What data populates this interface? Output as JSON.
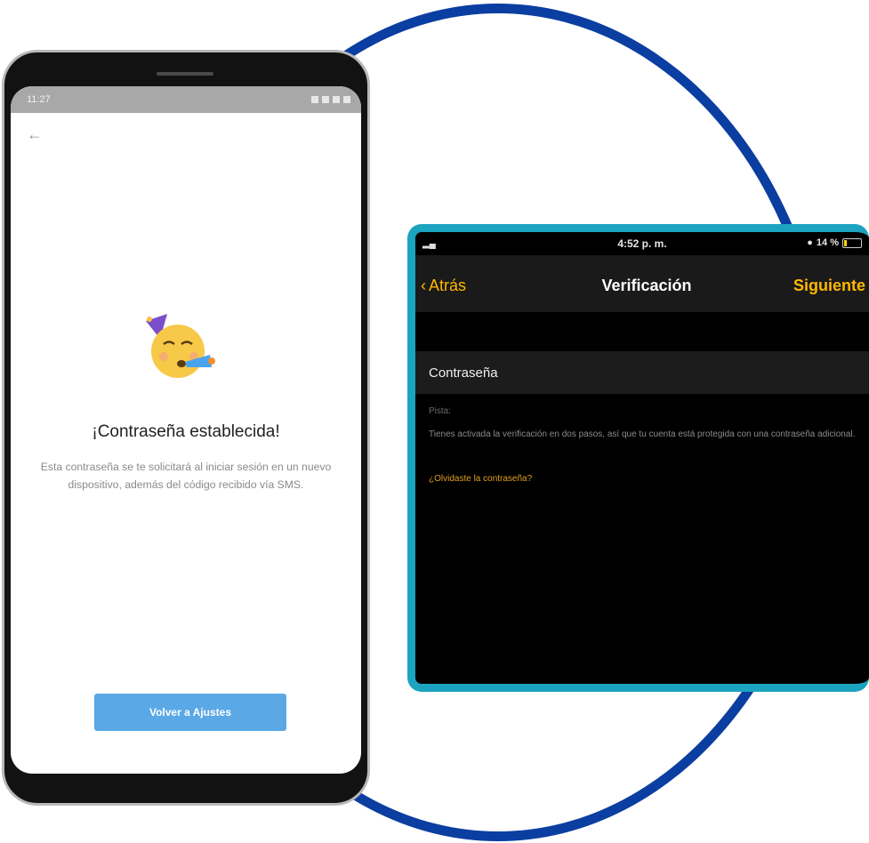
{
  "android": {
    "status_time": "11:27",
    "back_icon": "arrow-left-icon",
    "emoji": "partying-face-icon",
    "headline": "¡Contraseña establecida!",
    "description": "Esta contraseña se te solicitará al iniciar sesión en un nuevo dispositivo, además del código recibido vía SMS.",
    "button_label": "Volver a Ajustes",
    "button_color": "#5aa8e6"
  },
  "ios": {
    "status_time": "4:52 p. m.",
    "battery": "14 %",
    "nav_back": "Atrás",
    "nav_title": "Verificación",
    "nav_next": "Siguiente",
    "accent_color": "#ffb700",
    "row_label": "Contraseña",
    "hint_label": "Pista:",
    "info_text": "Tienes activada la verificación en dos pasos, así que tu cuenta está protegida con una contraseña adicional.",
    "forgot_link": "¿Olvidaste la contraseña?"
  },
  "colors": {
    "ring": "#0b3ea1",
    "ios_frame": "#1ca3c0"
  }
}
